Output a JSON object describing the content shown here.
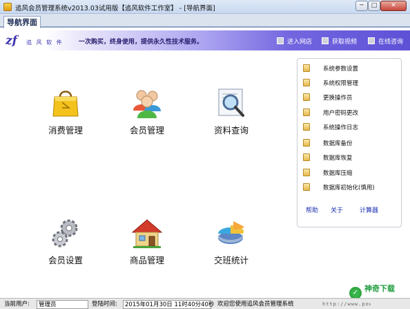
{
  "window": {
    "title": "追风会员管理系统v2013.03试用版【追风软件工作室】 - [导航界面]",
    "min_label": "─",
    "max_label": "□",
    "close_label": "✕"
  },
  "tabs": [
    {
      "label": "导航界面"
    }
  ],
  "banner": {
    "brand_logo": "zf",
    "brand_name": "追 风 软 件",
    "slogan": "一次购买，终身使用，提供永久性技术服务。",
    "links": [
      {
        "label": "进入网店"
      },
      {
        "label": "获取视频"
      },
      {
        "label": "在线咨询"
      }
    ]
  },
  "modules": [
    {
      "label": "消费管理",
      "icon": "shopping-bag-icon"
    },
    {
      "label": "会员管理",
      "icon": "members-icon"
    },
    {
      "label": "资料查询",
      "icon": "magnifier-icon"
    },
    {
      "label": "会员设置",
      "icon": "gears-icon"
    },
    {
      "label": "商品管理",
      "icon": "house-icon"
    },
    {
      "label": "交班统计",
      "icon": "pie-chart-icon"
    }
  ],
  "side_menu": {
    "items": [
      {
        "label": "系统参数设置"
      },
      {
        "label": "系统权限管理"
      },
      {
        "label": "更换操作员"
      },
      {
        "label": "用户密码更改"
      },
      {
        "label": "系统操作日志"
      },
      {
        "label": "数据库备份"
      },
      {
        "label": "数据库恢复"
      },
      {
        "label": "数据库压缩"
      },
      {
        "label": "数据库初始化(慎用)"
      }
    ],
    "links": [
      {
        "label": "帮助"
      },
      {
        "label": "关于"
      },
      {
        "label": "计算器"
      }
    ]
  },
  "status": {
    "user_label": "当前用户:",
    "user": "管理员",
    "login_label": "登陆时间:",
    "login_time": "2015年01月30日  11时40分40秒",
    "welcome": "欢迎您使用追风会员管理系统",
    "url": "http://www.powerzf"
  },
  "watermark": "神奇下载"
}
